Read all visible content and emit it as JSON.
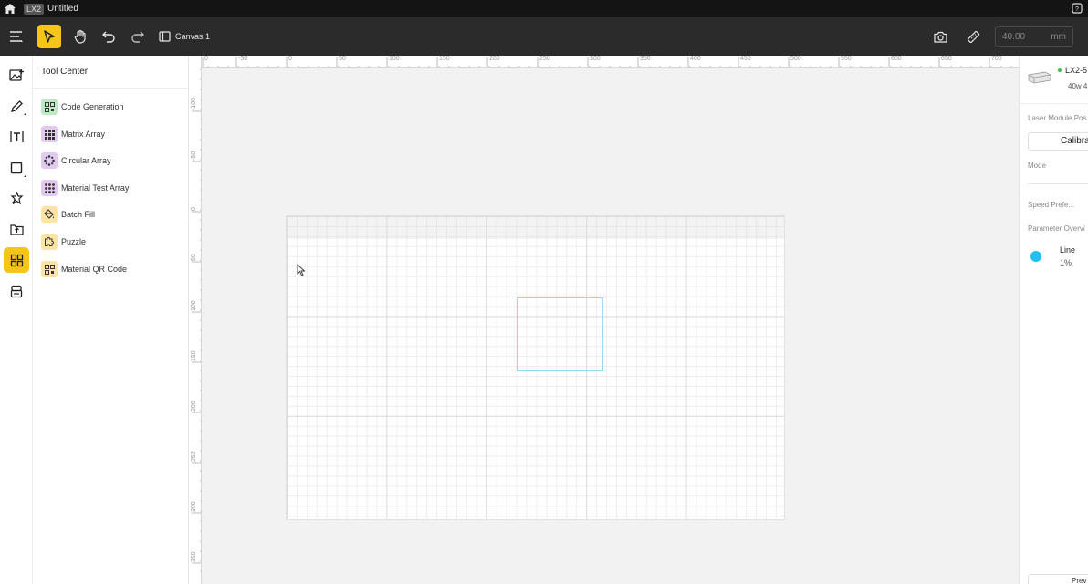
{
  "titlebar": {
    "app_badge": "LX2",
    "document_title": "Untitled",
    "icons": [
      "home-icon",
      "help-icon"
    ]
  },
  "toolbar": {
    "canvas_tab_label": "Canvas 1",
    "size_input_value": "40.00",
    "size_unit": "mm",
    "active_tool": "select",
    "icons": [
      "menu-icon",
      "select-arrow-icon",
      "hand-pan-icon",
      "undo-icon",
      "redo-icon",
      "canvas-tab-icon",
      "camera-icon",
      "measure-icon"
    ]
  },
  "left_toolbar": {
    "items": [
      "image-add",
      "pen",
      "text",
      "shape",
      "magic-tool",
      "import",
      "tool-center",
      "material-library"
    ],
    "active_item": "tool-center"
  },
  "tool_center": {
    "title": "Tool Center",
    "items": [
      {
        "label": "Code Generation",
        "icon": "qr-code-icon",
        "color": "#bfe8c5"
      },
      {
        "label": "Matrix Array",
        "icon": "grid-icon",
        "color": "#e3c9f0"
      },
      {
        "label": "Circular Array",
        "icon": "circular-array-icon",
        "color": "#e3c9f0"
      },
      {
        "label": "Material Test Array",
        "icon": "dots-grid-icon",
        "color": "#e3c9f0"
      },
      {
        "label": "Batch Fill",
        "icon": "fill-bucket-icon",
        "color": "#fde3a6"
      },
      {
        "label": "Puzzle",
        "icon": "puzzle-icon",
        "color": "#fde3a6"
      },
      {
        "label": "Material QR Code",
        "icon": "qr-code-icon",
        "color": "#fde3a6"
      }
    ]
  },
  "rulers": {
    "top_labels": [
      "0",
      "-50",
      "0",
      "50",
      "100",
      "150",
      "200",
      "250",
      "300",
      "350",
      "400",
      "450",
      "500",
      "550",
      "600",
      "650",
      "700"
    ],
    "left_labels": [
      "-100",
      "-50",
      "0",
      "50",
      "100",
      "150",
      "200",
      "250",
      "300",
      "350"
    ]
  },
  "right_panel": {
    "device_name": "LX2-5",
    "device_spec": "40w 4",
    "laser_module_label": "Laser Module Pos",
    "calibrate_label": "Calibra",
    "mode_label": "Mode",
    "speed_label": "Speed Prefe...",
    "parameter_overview_label": "Parameter Overvi",
    "param_name": "Line",
    "param_value": "1%",
    "param_color": "#22c0f0",
    "preview_label": "Prev"
  }
}
